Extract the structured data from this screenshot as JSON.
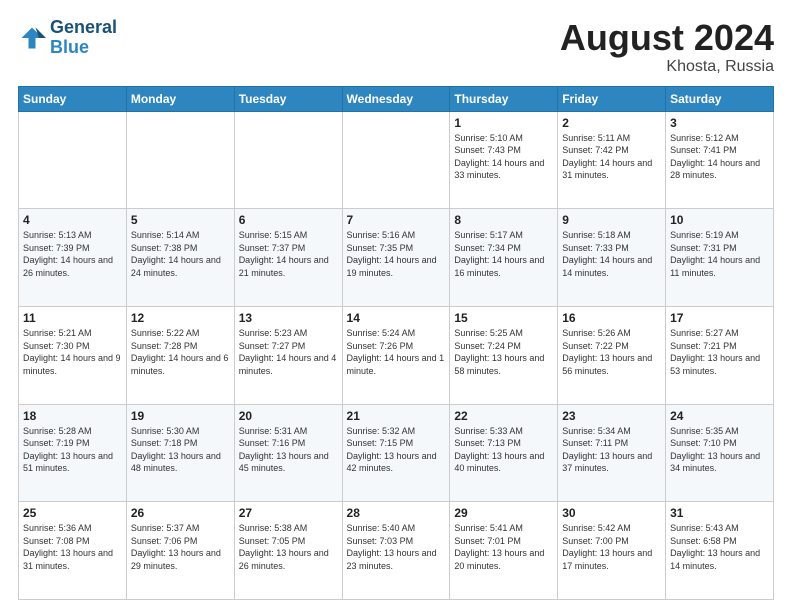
{
  "header": {
    "logo_line1": "General",
    "logo_line2": "Blue",
    "month": "August 2024",
    "location": "Khosta, Russia"
  },
  "weekdays": [
    "Sunday",
    "Monday",
    "Tuesday",
    "Wednesday",
    "Thursday",
    "Friday",
    "Saturday"
  ],
  "weeks": [
    [
      {
        "day": "",
        "info": ""
      },
      {
        "day": "",
        "info": ""
      },
      {
        "day": "",
        "info": ""
      },
      {
        "day": "",
        "info": ""
      },
      {
        "day": "1",
        "info": "Sunrise: 5:10 AM\nSunset: 7:43 PM\nDaylight: 14 hours\nand 33 minutes."
      },
      {
        "day": "2",
        "info": "Sunrise: 5:11 AM\nSunset: 7:42 PM\nDaylight: 14 hours\nand 31 minutes."
      },
      {
        "day": "3",
        "info": "Sunrise: 5:12 AM\nSunset: 7:41 PM\nDaylight: 14 hours\nand 28 minutes."
      }
    ],
    [
      {
        "day": "4",
        "info": "Sunrise: 5:13 AM\nSunset: 7:39 PM\nDaylight: 14 hours\nand 26 minutes."
      },
      {
        "day": "5",
        "info": "Sunrise: 5:14 AM\nSunset: 7:38 PM\nDaylight: 14 hours\nand 24 minutes."
      },
      {
        "day": "6",
        "info": "Sunrise: 5:15 AM\nSunset: 7:37 PM\nDaylight: 14 hours\nand 21 minutes."
      },
      {
        "day": "7",
        "info": "Sunrise: 5:16 AM\nSunset: 7:35 PM\nDaylight: 14 hours\nand 19 minutes."
      },
      {
        "day": "8",
        "info": "Sunrise: 5:17 AM\nSunset: 7:34 PM\nDaylight: 14 hours\nand 16 minutes."
      },
      {
        "day": "9",
        "info": "Sunrise: 5:18 AM\nSunset: 7:33 PM\nDaylight: 14 hours\nand 14 minutes."
      },
      {
        "day": "10",
        "info": "Sunrise: 5:19 AM\nSunset: 7:31 PM\nDaylight: 14 hours\nand 11 minutes."
      }
    ],
    [
      {
        "day": "11",
        "info": "Sunrise: 5:21 AM\nSunset: 7:30 PM\nDaylight: 14 hours\nand 9 minutes."
      },
      {
        "day": "12",
        "info": "Sunrise: 5:22 AM\nSunset: 7:28 PM\nDaylight: 14 hours\nand 6 minutes."
      },
      {
        "day": "13",
        "info": "Sunrise: 5:23 AM\nSunset: 7:27 PM\nDaylight: 14 hours\nand 4 minutes."
      },
      {
        "day": "14",
        "info": "Sunrise: 5:24 AM\nSunset: 7:26 PM\nDaylight: 14 hours\nand 1 minute."
      },
      {
        "day": "15",
        "info": "Sunrise: 5:25 AM\nSunset: 7:24 PM\nDaylight: 13 hours\nand 58 minutes."
      },
      {
        "day": "16",
        "info": "Sunrise: 5:26 AM\nSunset: 7:22 PM\nDaylight: 13 hours\nand 56 minutes."
      },
      {
        "day": "17",
        "info": "Sunrise: 5:27 AM\nSunset: 7:21 PM\nDaylight: 13 hours\nand 53 minutes."
      }
    ],
    [
      {
        "day": "18",
        "info": "Sunrise: 5:28 AM\nSunset: 7:19 PM\nDaylight: 13 hours\nand 51 minutes."
      },
      {
        "day": "19",
        "info": "Sunrise: 5:30 AM\nSunset: 7:18 PM\nDaylight: 13 hours\nand 48 minutes."
      },
      {
        "day": "20",
        "info": "Sunrise: 5:31 AM\nSunset: 7:16 PM\nDaylight: 13 hours\nand 45 minutes."
      },
      {
        "day": "21",
        "info": "Sunrise: 5:32 AM\nSunset: 7:15 PM\nDaylight: 13 hours\nand 42 minutes."
      },
      {
        "day": "22",
        "info": "Sunrise: 5:33 AM\nSunset: 7:13 PM\nDaylight: 13 hours\nand 40 minutes."
      },
      {
        "day": "23",
        "info": "Sunrise: 5:34 AM\nSunset: 7:11 PM\nDaylight: 13 hours\nand 37 minutes."
      },
      {
        "day": "24",
        "info": "Sunrise: 5:35 AM\nSunset: 7:10 PM\nDaylight: 13 hours\nand 34 minutes."
      }
    ],
    [
      {
        "day": "25",
        "info": "Sunrise: 5:36 AM\nSunset: 7:08 PM\nDaylight: 13 hours\nand 31 minutes."
      },
      {
        "day": "26",
        "info": "Sunrise: 5:37 AM\nSunset: 7:06 PM\nDaylight: 13 hours\nand 29 minutes."
      },
      {
        "day": "27",
        "info": "Sunrise: 5:38 AM\nSunset: 7:05 PM\nDaylight: 13 hours\nand 26 minutes."
      },
      {
        "day": "28",
        "info": "Sunrise: 5:40 AM\nSunset: 7:03 PM\nDaylight: 13 hours\nand 23 minutes."
      },
      {
        "day": "29",
        "info": "Sunrise: 5:41 AM\nSunset: 7:01 PM\nDaylight: 13 hours\nand 20 minutes."
      },
      {
        "day": "30",
        "info": "Sunrise: 5:42 AM\nSunset: 7:00 PM\nDaylight: 13 hours\nand 17 minutes."
      },
      {
        "day": "31",
        "info": "Sunrise: 5:43 AM\nSunset: 6:58 PM\nDaylight: 13 hours\nand 14 minutes."
      }
    ]
  ]
}
